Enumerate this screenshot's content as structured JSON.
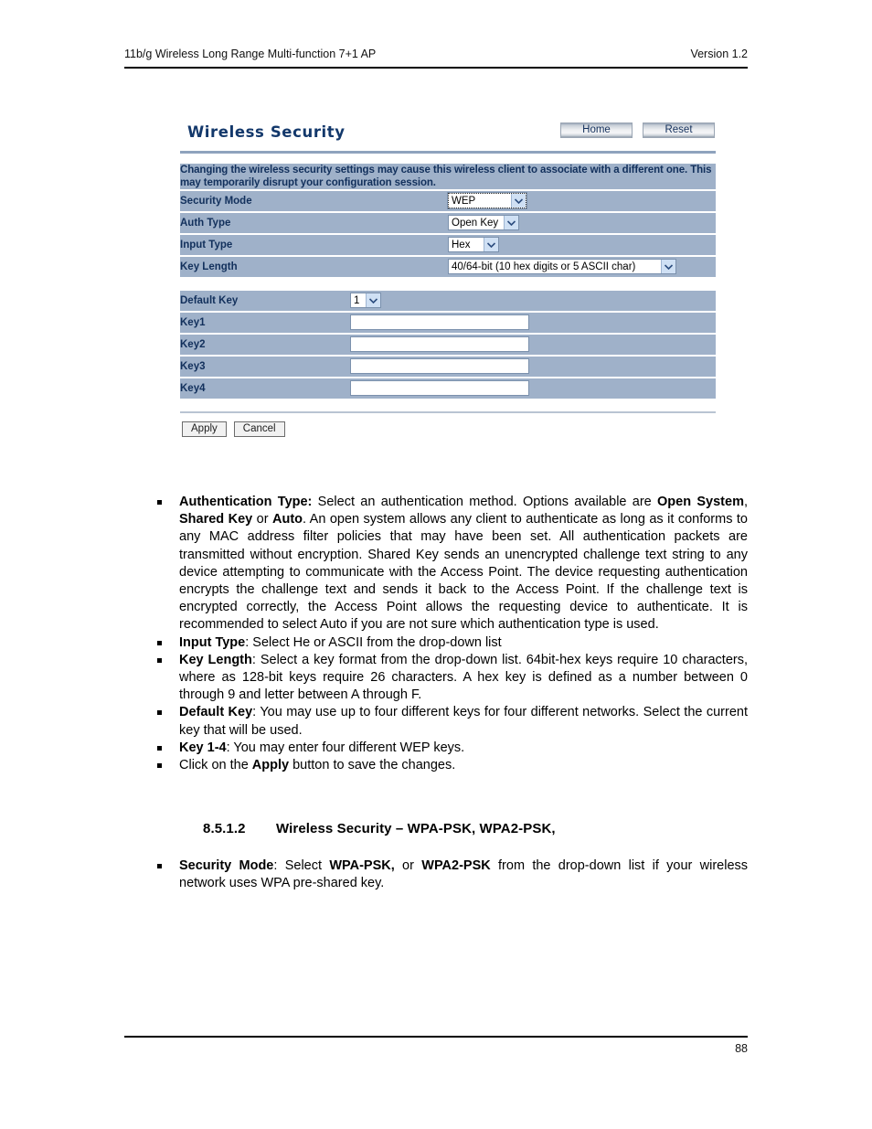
{
  "page": {
    "header_left": "11b/g Wireless Long Range Multi-function 7+1 AP",
    "header_right": "Version 1.2",
    "page_number": "88"
  },
  "screenshot": {
    "title": "Wireless Security",
    "buttons": {
      "home": "Home",
      "reset": "Reset"
    },
    "notice": "Changing the wireless security settings may cause this wireless client to associate with a different one. This may temporarily disrupt your configuration session.",
    "fields": [
      {
        "label": "Security Mode",
        "control": "select",
        "value": "WEP"
      },
      {
        "label": "Auth Type",
        "control": "select",
        "value": "Open Key"
      },
      {
        "label": "Input Type",
        "control": "select",
        "value": "Hex"
      },
      {
        "label": "Key Length",
        "control": "select",
        "value": "40/64-bit (10 hex digits or 5 ASCII char)"
      }
    ],
    "key_fields": [
      {
        "label": "Default Key",
        "control": "select",
        "value": "1"
      },
      {
        "label": "Key1",
        "control": "text",
        "value": ""
      },
      {
        "label": "Key2",
        "control": "text",
        "value": ""
      },
      {
        "label": "Key3",
        "control": "text",
        "value": ""
      },
      {
        "label": "Key4",
        "control": "text",
        "value": ""
      }
    ],
    "actions": {
      "apply": "Apply",
      "cancel": "Cancel"
    }
  },
  "body": {
    "bullets": [
      {
        "lead": "Authentication Type:",
        "text_1": " Select an authentication method. Options available are ",
        "bold_1": "Open System",
        "text_2": ", ",
        "bold_2": "Shared Key",
        "text_3": " or ",
        "bold_3": "Auto",
        "text_4": ". An open system allows any client to authenticate as long as it conforms to any MAC address filter policies that may have been set. All authentication packets are transmitted without encryption. Shared Key sends an unencrypted challenge text string to any device attempting to communicate with the Access Point. The device requesting authentication encrypts the challenge text and sends it back to the Access Point. If the challenge text is encrypted correctly, the Access Point allows the requesting device to authenticate. It is recommended to select Auto if you are not sure which authentication type is used."
      },
      {
        "lead": "Input Type",
        "text_1": ": Select He or ASCII from the drop-down list"
      },
      {
        "lead": "Key Length",
        "text_1": ": Select a key format from the drop-down list. 64bit-hex keys require 10 characters, where as 128-bit keys require 26 characters. A hex key is defined as a number between 0 through 9 and letter between A through F."
      },
      {
        "lead": "Default Key",
        "text_1": ": You may use up to four different keys for four different networks. Select the current key that will be used."
      },
      {
        "lead": "Key 1-4",
        "text_1": ": You may enter four different WEP keys."
      },
      {
        "lead": "",
        "text_1": "Click on the ",
        "bold_1": "Apply",
        "text_2": " button to save the changes."
      }
    ],
    "section_heading": {
      "number": "8.5.1.2",
      "title": "Wireless Security – WPA-PSK, WPA2-PSK,"
    },
    "section_bullet": {
      "lead": "Security Mode",
      "text_1": ": Select ",
      "bold_1": "WPA-PSK,",
      "text_2": " or ",
      "bold_2": "WPA2-PSK",
      "text_3": " from the drop-down list if your wireless network uses WPA pre-shared key."
    }
  },
  "colors": {
    "row_bg": "#9fb1c9",
    "label_text": "#12305c",
    "title_text": "#13386b",
    "rule": "#8fa3bd"
  }
}
